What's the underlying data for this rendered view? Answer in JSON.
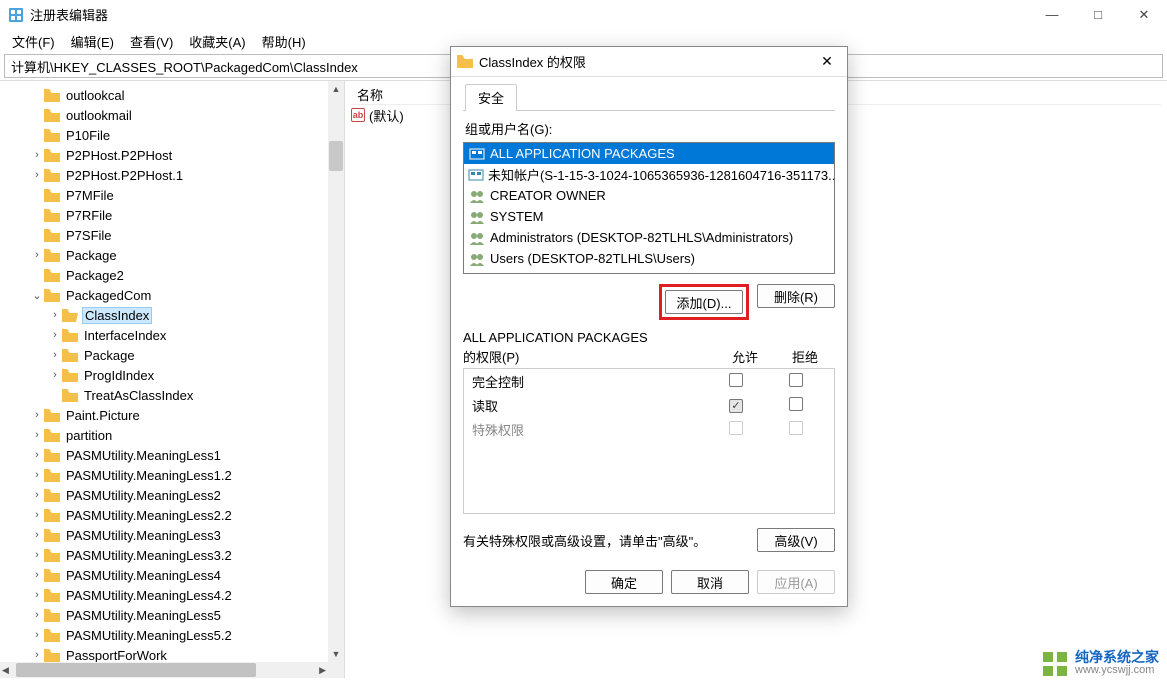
{
  "window": {
    "title": "注册表编辑器",
    "minimize": "—",
    "maximize": "□",
    "close": "✕"
  },
  "menu": {
    "file": "文件(F)",
    "edit": "编辑(E)",
    "view": "查看(V)",
    "favorites": "收藏夹(A)",
    "help": "帮助(H)"
  },
  "address": "计算机\\HKEY_CLASSES_ROOT\\PackagedCom\\ClassIndex",
  "tree": [
    {
      "indent": 1,
      "exp": "",
      "label": "outlookcal"
    },
    {
      "indent": 1,
      "exp": "",
      "label": "outlookmail"
    },
    {
      "indent": 1,
      "exp": "",
      "label": "P10File"
    },
    {
      "indent": 1,
      "exp": ">",
      "label": "P2PHost.P2PHost"
    },
    {
      "indent": 1,
      "exp": ">",
      "label": "P2PHost.P2PHost.1"
    },
    {
      "indent": 1,
      "exp": "",
      "label": "P7MFile"
    },
    {
      "indent": 1,
      "exp": "",
      "label": "P7RFile"
    },
    {
      "indent": 1,
      "exp": "",
      "label": "P7SFile"
    },
    {
      "indent": 1,
      "exp": ">",
      "label": "Package"
    },
    {
      "indent": 1,
      "exp": "",
      "label": "Package2"
    },
    {
      "indent": 1,
      "exp": "v",
      "label": "PackagedCom"
    },
    {
      "indent": 2,
      "exp": ">",
      "label": "ClassIndex",
      "selected": true,
      "open": true
    },
    {
      "indent": 2,
      "exp": ">",
      "label": "InterfaceIndex"
    },
    {
      "indent": 2,
      "exp": ">",
      "label": "Package"
    },
    {
      "indent": 2,
      "exp": ">",
      "label": "ProgIdIndex"
    },
    {
      "indent": 2,
      "exp": "",
      "label": "TreatAsClassIndex"
    },
    {
      "indent": 1,
      "exp": ">",
      "label": "Paint.Picture"
    },
    {
      "indent": 1,
      "exp": ">",
      "label": "partition"
    },
    {
      "indent": 1,
      "exp": ">",
      "label": "PASMUtility.MeaningLess1"
    },
    {
      "indent": 1,
      "exp": ">",
      "label": "PASMUtility.MeaningLess1.2"
    },
    {
      "indent": 1,
      "exp": ">",
      "label": "PASMUtility.MeaningLess2"
    },
    {
      "indent": 1,
      "exp": ">",
      "label": "PASMUtility.MeaningLess2.2"
    },
    {
      "indent": 1,
      "exp": ">",
      "label": "PASMUtility.MeaningLess3"
    },
    {
      "indent": 1,
      "exp": ">",
      "label": "PASMUtility.MeaningLess3.2"
    },
    {
      "indent": 1,
      "exp": ">",
      "label": "PASMUtility.MeaningLess4"
    },
    {
      "indent": 1,
      "exp": ">",
      "label": "PASMUtility.MeaningLess4.2"
    },
    {
      "indent": 1,
      "exp": ">",
      "label": "PASMUtility.MeaningLess5"
    },
    {
      "indent": 1,
      "exp": ">",
      "label": "PASMUtility.MeaningLess5.2"
    },
    {
      "indent": 1,
      "exp": ">",
      "label": "PassportForWork"
    }
  ],
  "list": {
    "header_name": "名称",
    "default_row": "(默认)"
  },
  "dialog": {
    "title": "ClassIndex 的权限",
    "tab_security": "安全",
    "group_label": "组或用户名(G):",
    "users": [
      {
        "name": "ALL APPLICATION PACKAGES",
        "selected": true,
        "icon": "pkg"
      },
      {
        "name": "未知帐户(S-1-15-3-1024-1065365936-1281604716-351173...",
        "icon": "pkg"
      },
      {
        "name": "CREATOR OWNER",
        "icon": "grp"
      },
      {
        "name": "SYSTEM",
        "icon": "grp"
      },
      {
        "name": "Administrators (DESKTOP-82TLHLS\\Administrators)",
        "icon": "grp"
      },
      {
        "name": "Users (DESKTOP-82TLHLS\\Users)",
        "icon": "grp"
      }
    ],
    "add_btn": "添加(D)...",
    "remove_btn": "删除(R)",
    "perm_title_1": "ALL APPLICATION PACKAGES",
    "perm_title_2": "的权限(P)",
    "col_allow": "允许",
    "col_deny": "拒绝",
    "perms": [
      {
        "label": "完全控制",
        "allow": false,
        "deny": false,
        "readonly": false
      },
      {
        "label": "读取",
        "allow": true,
        "deny": false,
        "readonly": true
      },
      {
        "label": "特殊权限",
        "allow": false,
        "deny": false,
        "dim": true
      }
    ],
    "advanced_note": "有关特殊权限或高级设置，请单击\"高级\"。",
    "advanced_btn": "高级(V)",
    "ok_btn": "确定",
    "cancel_btn": "取消",
    "apply_btn": "应用(A)"
  },
  "watermark": {
    "line1": "纯净系统之家",
    "line2": "www.ycswjj.com"
  }
}
